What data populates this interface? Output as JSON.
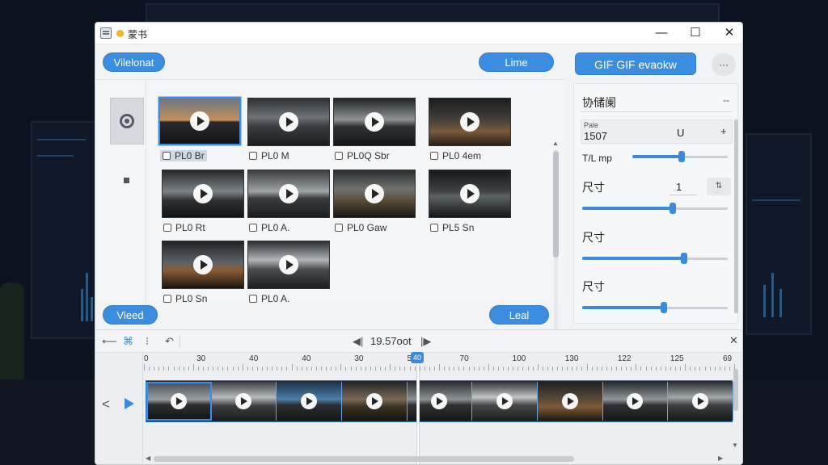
{
  "window": {
    "title": "蒙书"
  },
  "toolbar": {
    "left_pill": "Vilelonat",
    "mid_pill": "Lime",
    "gif_button": "GIF GIF evaokw",
    "more_label": "···"
  },
  "grid": {
    "items": [
      {
        "label": "PL0 Br",
        "selected": true
      },
      {
        "label": "PL0 M"
      },
      {
        "label": "PL0Q Sbr"
      },
      {
        "label": "PL0 4em"
      },
      {
        "label": "PL0 Rt"
      },
      {
        "label": "PL0 A."
      },
      {
        "label": "PL0 Gaw"
      },
      {
        "label": "PL5 Sn"
      },
      {
        "label": "PL0 Sn"
      },
      {
        "label": "PL0 A."
      }
    ]
  },
  "bottom_buttons": {
    "left": "Vleed",
    "right": "Leal"
  },
  "panel": {
    "title": "协储阑",
    "dash": "--",
    "field_small": "Pale",
    "field_value": "1507",
    "field_u": "U",
    "field_plus": "+",
    "tmp_label": "T/L  mp",
    "size_label_1": "尺寸",
    "size_value": "1",
    "size_label_2": "尺寸",
    "size_label_3": "尺寸",
    "stepper": "⇅",
    "sliders": [
      0.52,
      0.62,
      0.7,
      0.56
    ],
    "accent": "#3a8bdc"
  },
  "timeline": {
    "time_readout": "19.57oot",
    "playhead_label": "40",
    "ruler": [
      "0",
      "30",
      "40",
      "40",
      "30",
      "50",
      "70",
      "100",
      "130",
      "122",
      "125",
      "69"
    ],
    "clip_count": 9
  }
}
